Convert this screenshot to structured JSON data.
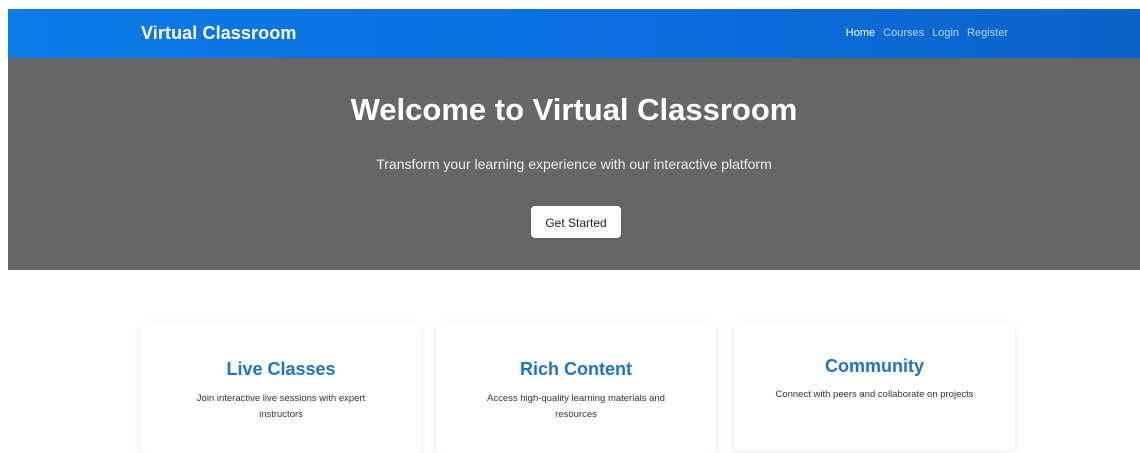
{
  "site": {
    "brand": "Virtual Classroom"
  },
  "navigation": {
    "links": [
      {
        "label": "Home",
        "active": true
      },
      {
        "label": "Courses",
        "active": false
      },
      {
        "label": "Login",
        "active": false
      },
      {
        "label": "Register",
        "active": false
      }
    ]
  },
  "hero": {
    "title": "Welcome to Virtual Classroom",
    "subtitle": "Transform your learning experience with our interactive platform",
    "button_label": "Get Started"
  },
  "features": [
    {
      "title": "Live Classes",
      "description": "Join interactive live sessions with expert instructors"
    },
    {
      "title": "Rich Content",
      "description": "Access high-quality learning materials and resources"
    },
    {
      "title": "Community",
      "description": "Connect with peers and collaborate on projects"
    }
  ],
  "colors": {
    "navbar": "#0A6FE0",
    "hero_background": "#666666",
    "feature_title": "#1F73C7"
  }
}
